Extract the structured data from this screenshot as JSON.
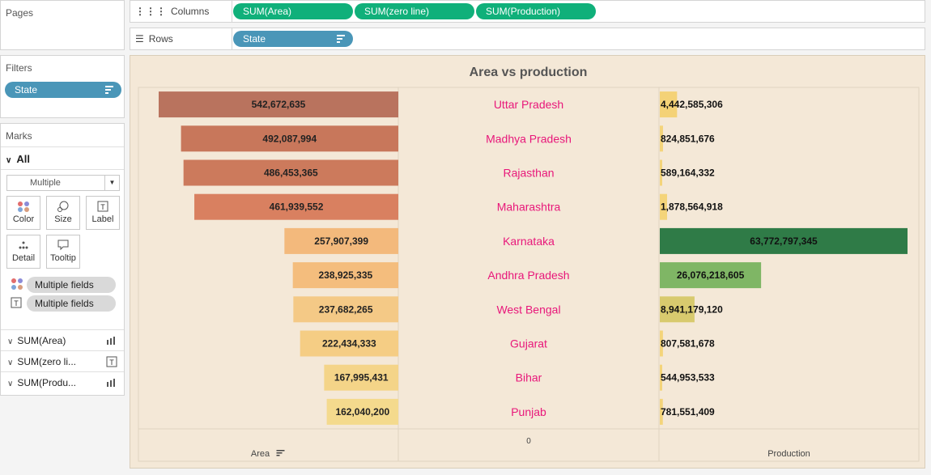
{
  "pages_panel": {
    "title": "Pages"
  },
  "filters_panel": {
    "title": "Filters",
    "pill": "State"
  },
  "marks_panel": {
    "title": "Marks",
    "all_label": "All",
    "mark_type": "Multiple",
    "buttons": {
      "color": "Color",
      "size": "Size",
      "label": "Label",
      "detail": "Detail",
      "tooltip": "Tooltip"
    },
    "field_pills": [
      "Multiple fields",
      "Multiple fields"
    ],
    "measure_rows": [
      "SUM(Area)",
      "SUM(zero li...",
      "SUM(Produ..."
    ]
  },
  "columns_shelf": {
    "label": "Columns",
    "pills": [
      "SUM(Area)",
      "SUM(zero line)",
      "SUM(Production)"
    ]
  },
  "rows_shelf": {
    "label": "Rows",
    "pill": "State"
  },
  "chart_data": {
    "type": "bar",
    "title": "Area vs production",
    "categories": [
      "Uttar Pradesh",
      "Madhya Pradesh",
      "Rajasthan",
      "Maharashtra",
      "Karnataka",
      "Andhra Pradesh",
      "West Bengal",
      "Gujarat",
      "Bihar",
      "Punjab"
    ],
    "series": [
      {
        "name": "Area",
        "values": [
          542672635,
          492087994,
          486453365,
          461939552,
          257907399,
          238925335,
          237682265,
          222434333,
          167995431,
          162040200
        ],
        "labels": [
          "542,672,635",
          "492,087,994",
          "486,453,365",
          "461,939,552",
          "257,907,399",
          "238,925,335",
          "237,682,265",
          "222,434,333",
          "167,995,431",
          "162,040,200"
        ]
      },
      {
        "name": "Production",
        "values": [
          4442585306,
          824851676,
          589164332,
          1878564918,
          63772797345,
          26076218605,
          8941179120,
          807581678,
          544953533,
          781551409
        ],
        "labels": [
          "4,442,585,306",
          "824,851,676",
          "589,164,332",
          "1,878,564,918",
          "63,772,797,345",
          "26,076,218,605",
          "8,941,179,120",
          "807,581,678",
          "544,953,533",
          "781,551,409"
        ]
      }
    ],
    "area_axis_label": "Area",
    "middle_axis_label": "0",
    "production_axis_label": "Production",
    "category_label_color": "#e8177a",
    "area_colors": [
      "#b9735e",
      "#c8775b",
      "#cc7a5c",
      "#d98060",
      "#f3b97c",
      "#f4bd7d",
      "#f4c986",
      "#f5cd84",
      "#f4d488",
      "#f4da8d"
    ],
    "production_colors": [
      "#f4d277",
      "#f4d47a",
      "#f4d47a",
      "#f4d47a",
      "#2f7b47",
      "#7fb665",
      "#d8ca6e",
      "#f4d47a",
      "#f4d47a",
      "#f4d47a"
    ]
  }
}
